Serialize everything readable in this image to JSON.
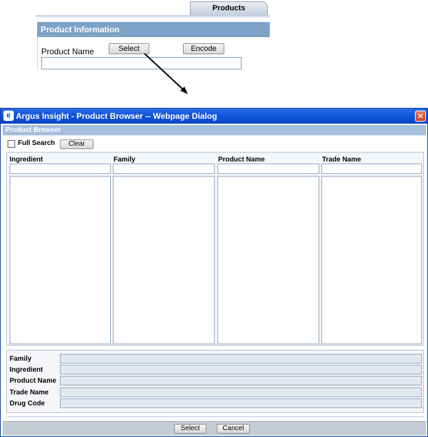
{
  "top": {
    "tab_label": "Products",
    "section_title": "Product Information",
    "product_name_label": "Product Name",
    "select_label": "Select",
    "encode_label": "Encode",
    "product_name_value": ""
  },
  "dialog": {
    "title": "Argus Insight - Product Browser -- Webpage Dialog",
    "close_glyph": "✕",
    "section_title": "Product Browser",
    "full_search_label": "Full Search",
    "clear_label": "Clear",
    "columns": [
      {
        "label": "Ingredient",
        "filter": ""
      },
      {
        "label": "Family",
        "filter": ""
      },
      {
        "label": "Product Name",
        "filter": ""
      },
      {
        "label": "Trade Name",
        "filter": ""
      }
    ],
    "details": [
      {
        "label": "Family",
        "value": ""
      },
      {
        "label": "Ingredient",
        "value": ""
      },
      {
        "label": "Product Name",
        "value": ""
      },
      {
        "label": "Trade Name",
        "value": ""
      },
      {
        "label": "Drug Code",
        "value": ""
      }
    ],
    "select_label": "Select",
    "cancel_label": "Cancel"
  },
  "colors": {
    "title_bar": "#0a4fd6",
    "section_bar": "#7fa2c8",
    "sub_bar": "#a6bfdd"
  }
}
